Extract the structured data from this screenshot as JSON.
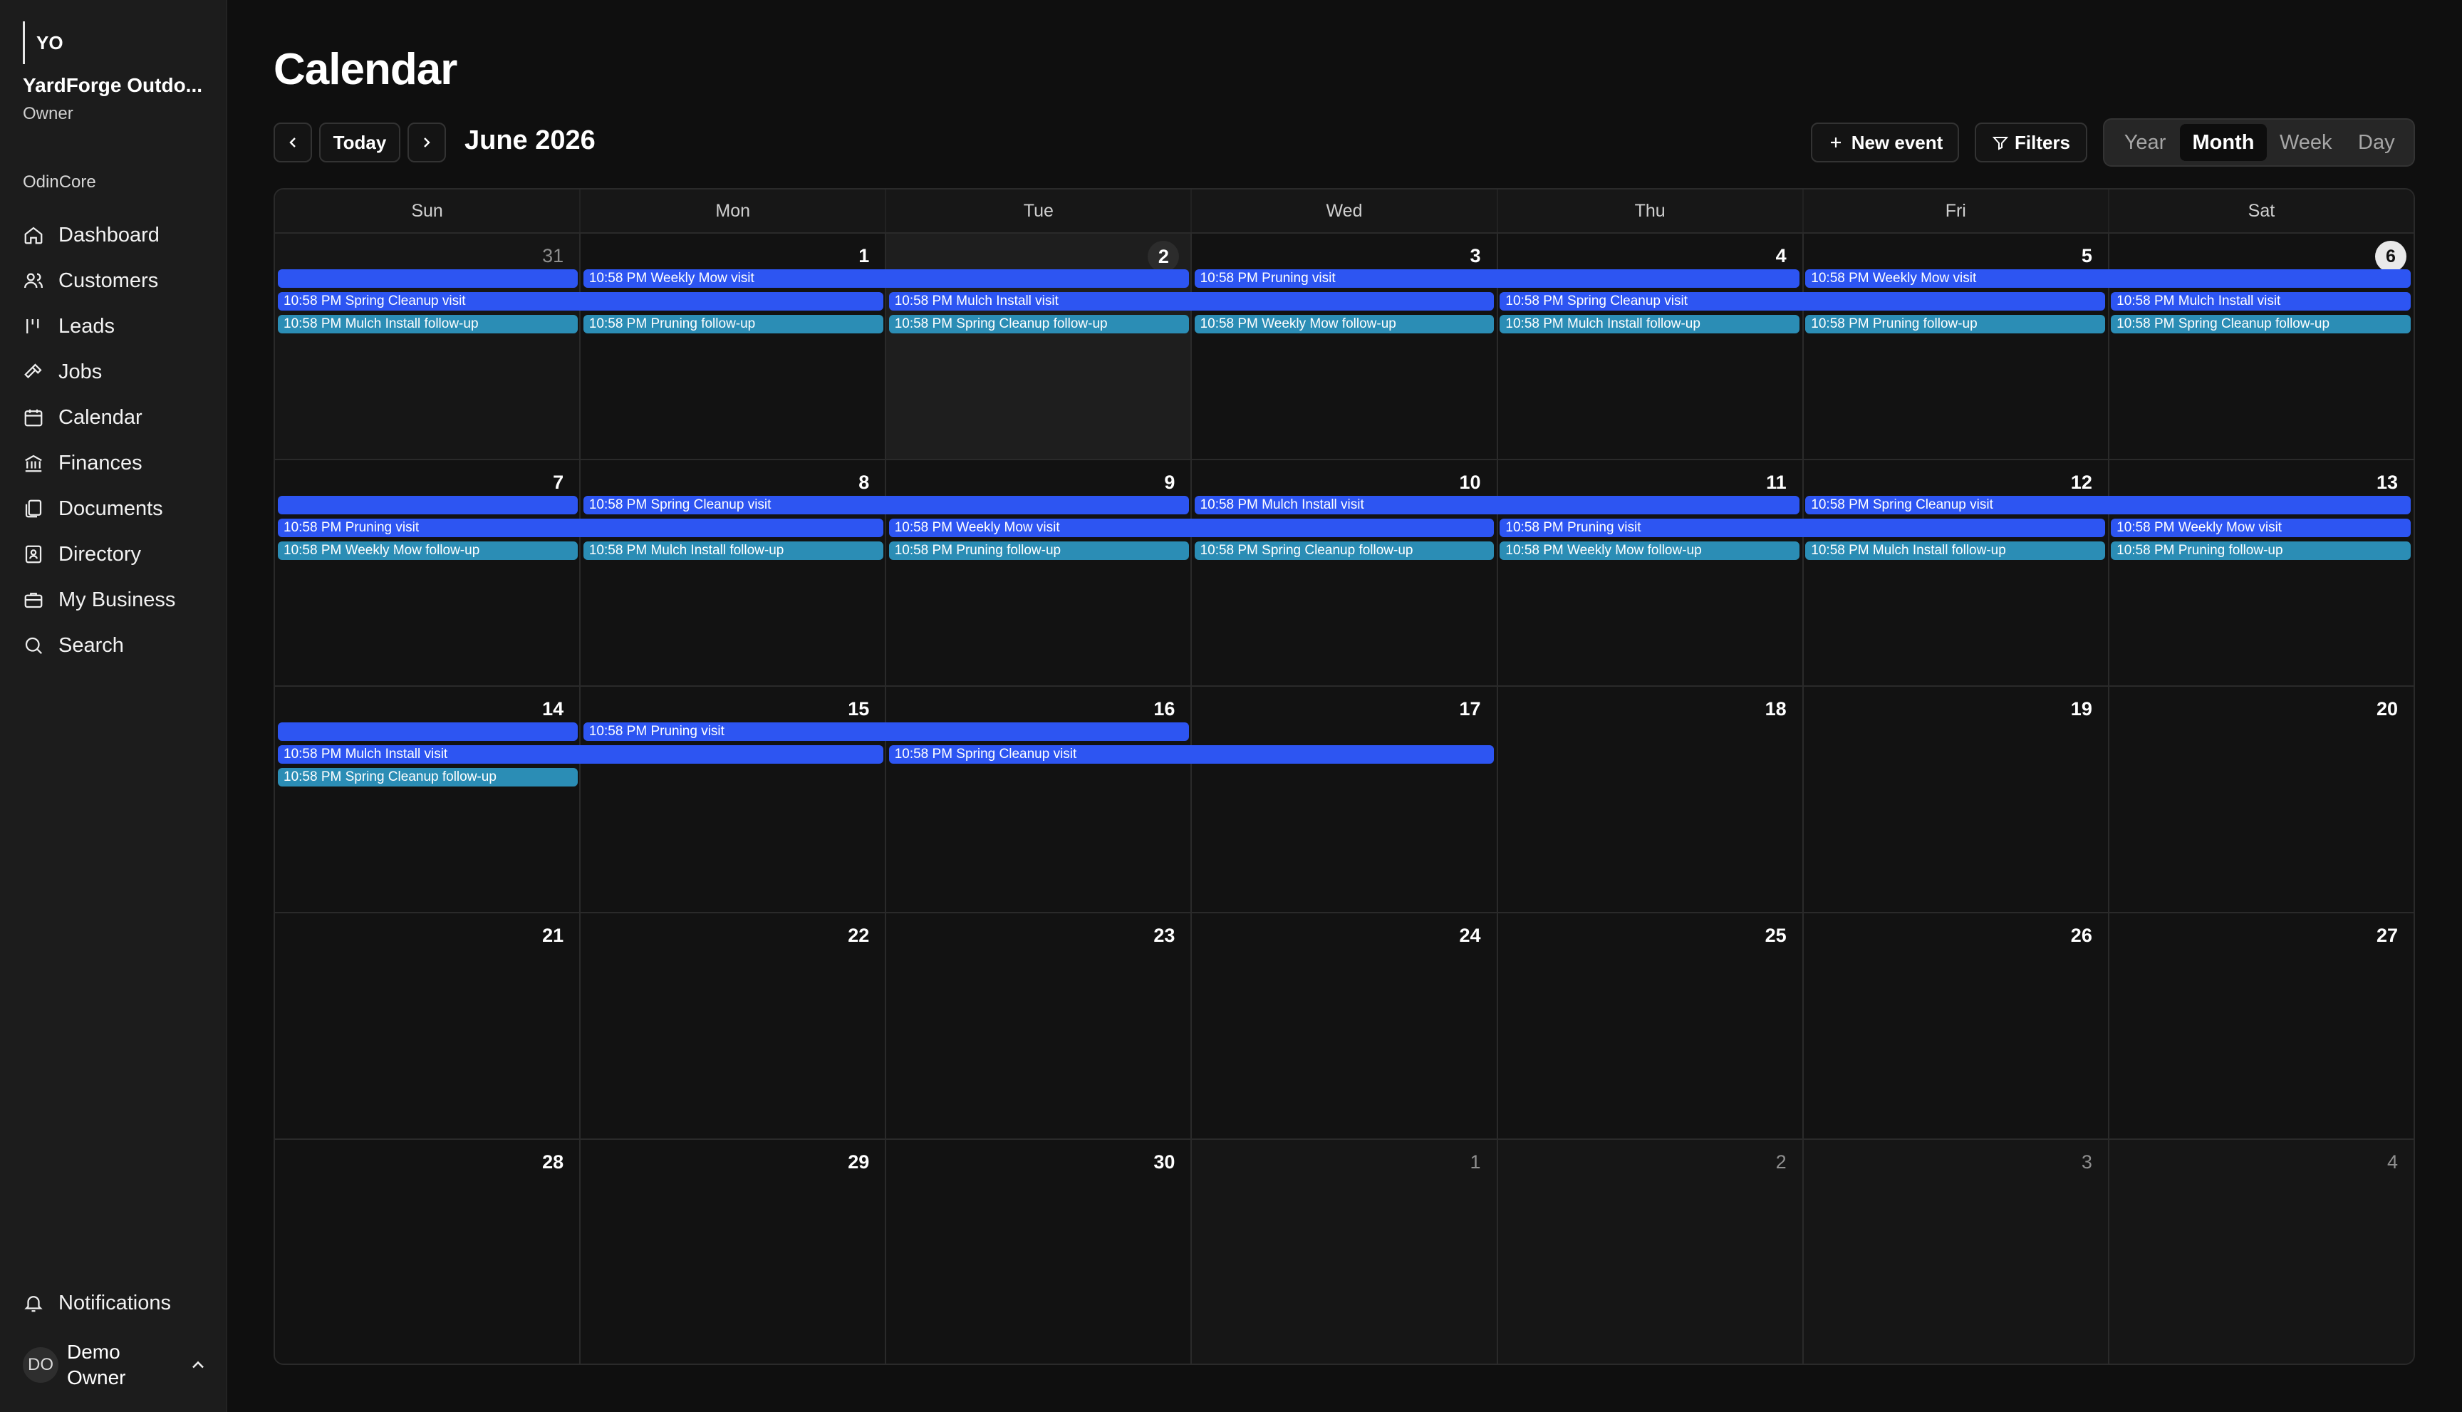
{
  "org": {
    "avatar": "YO",
    "name": "YardForge Outdo...",
    "role": "Owner"
  },
  "sidebar": {
    "section": "OdinCore",
    "items": [
      {
        "label": "Dashboard",
        "icon": "home-icon"
      },
      {
        "label": "Customers",
        "icon": "users-icon"
      },
      {
        "label": "Leads",
        "icon": "leads-icon"
      },
      {
        "label": "Jobs",
        "icon": "hammer-icon"
      },
      {
        "label": "Calendar",
        "icon": "calendar-icon"
      },
      {
        "label": "Finances",
        "icon": "bank-icon"
      },
      {
        "label": "Documents",
        "icon": "documents-icon"
      },
      {
        "label": "Directory",
        "icon": "contact-book-icon"
      },
      {
        "label": "My Business",
        "icon": "briefcase-icon"
      },
      {
        "label": "Search",
        "icon": "search-icon"
      }
    ],
    "notifications": "Notifications",
    "user": {
      "initials": "DO",
      "name": "Demo Owner"
    }
  },
  "page": {
    "title": "Calendar"
  },
  "toolbar": {
    "today": "Today",
    "month_label": "June 2026",
    "new_event": "New event",
    "filters": "Filters",
    "views": [
      "Year",
      "Month",
      "Week",
      "Day"
    ],
    "active_view": "Month"
  },
  "calendar": {
    "weekdays": [
      "Sun",
      "Mon",
      "Tue",
      "Wed",
      "Thu",
      "Fri",
      "Sat"
    ],
    "weeks": [
      [
        {
          "n": "31",
          "muted": true
        },
        {
          "n": "1"
        },
        {
          "n": "2",
          "selected": true
        },
        {
          "n": "3"
        },
        {
          "n": "4"
        },
        {
          "n": "5"
        },
        {
          "n": "6",
          "today": true
        }
      ],
      [
        {
          "n": "7"
        },
        {
          "n": "8"
        },
        {
          "n": "9"
        },
        {
          "n": "10"
        },
        {
          "n": "11"
        },
        {
          "n": "12"
        },
        {
          "n": "13"
        }
      ],
      [
        {
          "n": "14"
        },
        {
          "n": "15"
        },
        {
          "n": "16"
        },
        {
          "n": "17"
        },
        {
          "n": "18"
        },
        {
          "n": "19"
        },
        {
          "n": "20"
        }
      ],
      [
        {
          "n": "21"
        },
        {
          "n": "22"
        },
        {
          "n": "23"
        },
        {
          "n": "24"
        },
        {
          "n": "25"
        },
        {
          "n": "26"
        },
        {
          "n": "27"
        }
      ],
      [
        {
          "n": "28"
        },
        {
          "n": "29"
        },
        {
          "n": "30"
        },
        {
          "n": "1",
          "muted": true
        },
        {
          "n": "2",
          "muted": true
        },
        {
          "n": "3",
          "muted": true
        },
        {
          "n": "4",
          "muted": true
        }
      ]
    ],
    "events": [
      {
        "week": 0,
        "lane": 0,
        "start": 0,
        "span": 1,
        "kind": "visit",
        "label": ""
      },
      {
        "week": 0,
        "lane": 0,
        "start": 1,
        "span": 2,
        "kind": "visit",
        "label": "10:58 PM Weekly Mow visit"
      },
      {
        "week": 0,
        "lane": 0,
        "start": 3,
        "span": 2,
        "kind": "visit",
        "label": "10:58 PM Pruning visit"
      },
      {
        "week": 0,
        "lane": 0,
        "start": 5,
        "span": 2,
        "kind": "visit",
        "label": "10:58 PM Weekly Mow visit"
      },
      {
        "week": 0,
        "lane": 1,
        "start": 0,
        "span": 2,
        "kind": "visit",
        "label": "10:58 PM Spring Cleanup visit"
      },
      {
        "week": 0,
        "lane": 1,
        "start": 2,
        "span": 2,
        "kind": "visit",
        "label": "10:58 PM Mulch Install visit"
      },
      {
        "week": 0,
        "lane": 1,
        "start": 4,
        "span": 2,
        "kind": "visit",
        "label": "10:58 PM Spring Cleanup visit"
      },
      {
        "week": 0,
        "lane": 1,
        "start": 6,
        "span": 1,
        "kind": "visit",
        "label": "10:58 PM Mulch Install visit"
      },
      {
        "week": 0,
        "lane": 2,
        "start": 0,
        "span": 1,
        "kind": "follow",
        "label": "10:58 PM Mulch Install follow-up"
      },
      {
        "week": 0,
        "lane": 2,
        "start": 1,
        "span": 1,
        "kind": "follow",
        "label": "10:58 PM Pruning follow-up"
      },
      {
        "week": 0,
        "lane": 2,
        "start": 2,
        "span": 1,
        "kind": "follow",
        "label": "10:58 PM Spring Cleanup follow-up"
      },
      {
        "week": 0,
        "lane": 2,
        "start": 3,
        "span": 1,
        "kind": "follow",
        "label": "10:58 PM Weekly Mow follow-up"
      },
      {
        "week": 0,
        "lane": 2,
        "start": 4,
        "span": 1,
        "kind": "follow",
        "label": "10:58 PM Mulch Install follow-up"
      },
      {
        "week": 0,
        "lane": 2,
        "start": 5,
        "span": 1,
        "kind": "follow",
        "label": "10:58 PM Pruning follow-up"
      },
      {
        "week": 0,
        "lane": 2,
        "start": 6,
        "span": 1,
        "kind": "follow",
        "label": "10:58 PM Spring Cleanup follow-up"
      },
      {
        "week": 1,
        "lane": 0,
        "start": 0,
        "span": 1,
        "kind": "visit",
        "label": ""
      },
      {
        "week": 1,
        "lane": 0,
        "start": 1,
        "span": 2,
        "kind": "visit",
        "label": "10:58 PM Spring Cleanup visit"
      },
      {
        "week": 1,
        "lane": 0,
        "start": 3,
        "span": 2,
        "kind": "visit",
        "label": "10:58 PM Mulch Install visit"
      },
      {
        "week": 1,
        "lane": 0,
        "start": 5,
        "span": 2,
        "kind": "visit",
        "label": "10:58 PM Spring Cleanup visit"
      },
      {
        "week": 1,
        "lane": 1,
        "start": 0,
        "span": 2,
        "kind": "visit",
        "label": "10:58 PM Pruning visit"
      },
      {
        "week": 1,
        "lane": 1,
        "start": 2,
        "span": 2,
        "kind": "visit",
        "label": "10:58 PM Weekly Mow visit"
      },
      {
        "week": 1,
        "lane": 1,
        "start": 4,
        "span": 2,
        "kind": "visit",
        "label": "10:58 PM Pruning visit"
      },
      {
        "week": 1,
        "lane": 1,
        "start": 6,
        "span": 1,
        "kind": "visit",
        "label": "10:58 PM Weekly Mow visit"
      },
      {
        "week": 1,
        "lane": 2,
        "start": 0,
        "span": 1,
        "kind": "follow",
        "label": "10:58 PM Weekly Mow follow-up"
      },
      {
        "week": 1,
        "lane": 2,
        "start": 1,
        "span": 1,
        "kind": "follow",
        "label": "10:58 PM Mulch Install follow-up"
      },
      {
        "week": 1,
        "lane": 2,
        "start": 2,
        "span": 1,
        "kind": "follow",
        "label": "10:58 PM Pruning follow-up"
      },
      {
        "week": 1,
        "lane": 2,
        "start": 3,
        "span": 1,
        "kind": "follow",
        "label": "10:58 PM Spring Cleanup follow-up"
      },
      {
        "week": 1,
        "lane": 2,
        "start": 4,
        "span": 1,
        "kind": "follow",
        "label": "10:58 PM Weekly Mow follow-up"
      },
      {
        "week": 1,
        "lane": 2,
        "start": 5,
        "span": 1,
        "kind": "follow",
        "label": "10:58 PM Mulch Install follow-up"
      },
      {
        "week": 1,
        "lane": 2,
        "start": 6,
        "span": 1,
        "kind": "follow",
        "label": "10:58 PM Pruning follow-up"
      },
      {
        "week": 2,
        "lane": 0,
        "start": 0,
        "span": 1,
        "kind": "visit",
        "label": ""
      },
      {
        "week": 2,
        "lane": 0,
        "start": 1,
        "span": 2,
        "kind": "visit",
        "label": "10:58 PM Pruning visit"
      },
      {
        "week": 2,
        "lane": 1,
        "start": 0,
        "span": 2,
        "kind": "visit",
        "label": "10:58 PM Mulch Install visit"
      },
      {
        "week": 2,
        "lane": 1,
        "start": 2,
        "span": 2,
        "kind": "visit",
        "label": "10:58 PM Spring Cleanup visit"
      },
      {
        "week": 2,
        "lane": 2,
        "start": 0,
        "span": 1,
        "kind": "follow",
        "label": "10:58 PM Spring Cleanup follow-up"
      }
    ]
  }
}
